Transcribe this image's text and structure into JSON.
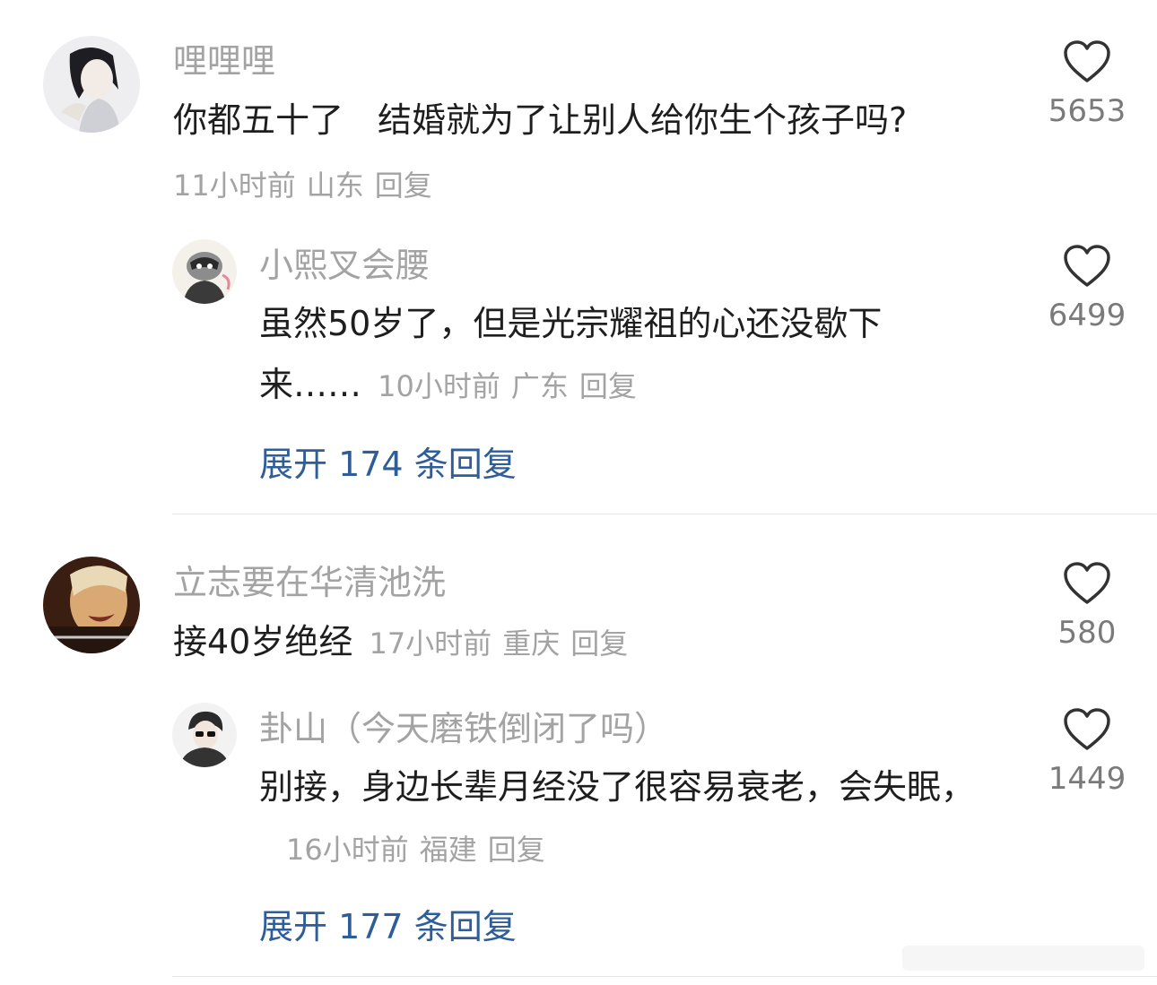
{
  "comments": [
    {
      "username": "哩哩哩",
      "text": "你都五十了　结婚就为了让别人给你生个孩子吗?",
      "time": "11小时前",
      "location": "山东",
      "reply_label": "回复",
      "likes": "5653",
      "reply": {
        "username": "小熙叉会腰",
        "text": "虽然50岁了，但是光宗耀祖的心还没歇下来……",
        "time": "10小时前",
        "location": "广东",
        "reply_label": "回复",
        "likes": "6499"
      },
      "expand_label": "展开 174 条回复"
    },
    {
      "username": "立志要在华清池洗",
      "text": "接40岁绝经",
      "time": "17小时前",
      "location": "重庆",
      "reply_label": "回复",
      "likes": "580",
      "reply": {
        "username": "卦山（今天磨铁倒闭了吗）",
        "text": "别接，身边长辈月经没了很容易衰老，会失眠，",
        "time": "16小时前",
        "location": "福建",
        "reply_label": "回复",
        "likes": "1449"
      },
      "expand_label": "展开 177 条回复"
    }
  ],
  "icons": {
    "like": "heart-outline-icon"
  },
  "colors": {
    "link": "#2f5d98",
    "meta": "#a3a3a3"
  }
}
